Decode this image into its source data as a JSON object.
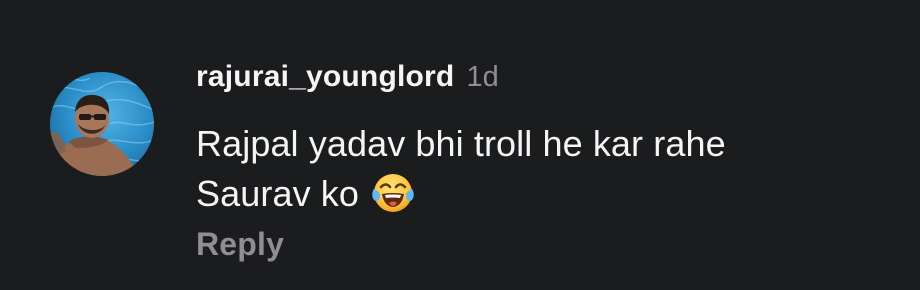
{
  "comment": {
    "username": "rajurai_younglord",
    "timestamp": "1d",
    "text_line1": "Rajpal yadav bhi troll he kar rahe",
    "text_line2": "Saurav ko",
    "emoji": "face-with-tears-of-joy-icon",
    "reply_label": "Reply"
  },
  "colors": {
    "background": "#1b1c1e",
    "text_primary": "#f5f5f5",
    "text_secondary": "#8e8e93",
    "avatar_pool": "#2e90c8"
  }
}
